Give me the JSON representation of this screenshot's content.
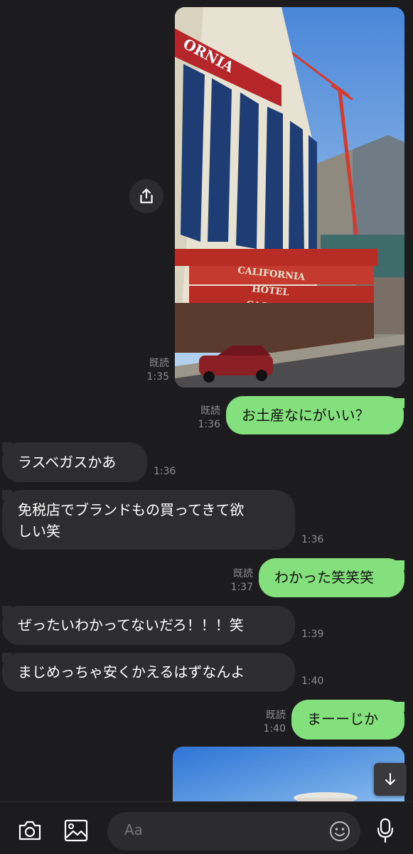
{
  "messages": {
    "m1": {
      "read": "既読",
      "time": "1:35"
    },
    "m2": {
      "text": "お土産なにがいい？",
      "read": "既読",
      "time": "1:36"
    },
    "m3": {
      "text": "ラスベガスかあ",
      "time": "1:36"
    },
    "m4": {
      "line1": "免税店でブランドもの買ってきて欲",
      "line2": "しい笑",
      "time": "1:36"
    },
    "m5": {
      "text": "わかった笑笑笑",
      "read": "既読",
      "time": "1:37"
    },
    "m6": {
      "text": "ぜったいわかってないだろ！！！笑",
      "time": "1:39"
    },
    "m7": {
      "text": "まじめっちゃ安くかえるはずなんよ",
      "time": "1:40"
    },
    "m8": {
      "text": "まーーじか",
      "read": "既読",
      "time": "1:40"
    }
  },
  "photo1": {
    "sign_top": "ORNIA",
    "sign_1": "CALIFORNIA",
    "sign_2": "HOTEL",
    "sign_3": "CASINO"
  },
  "composer": {
    "placeholder": "Aa"
  },
  "icons": {
    "share": "share-icon",
    "scroll": "arrow-down-icon",
    "camera": "camera-icon",
    "gallery": "image-icon",
    "emoji": "emoji-icon",
    "mic": "microphone-icon"
  },
  "colors": {
    "outgoing": "#84e07c",
    "incoming": "#2d2d2f",
    "background": "#1c1c1e"
  }
}
